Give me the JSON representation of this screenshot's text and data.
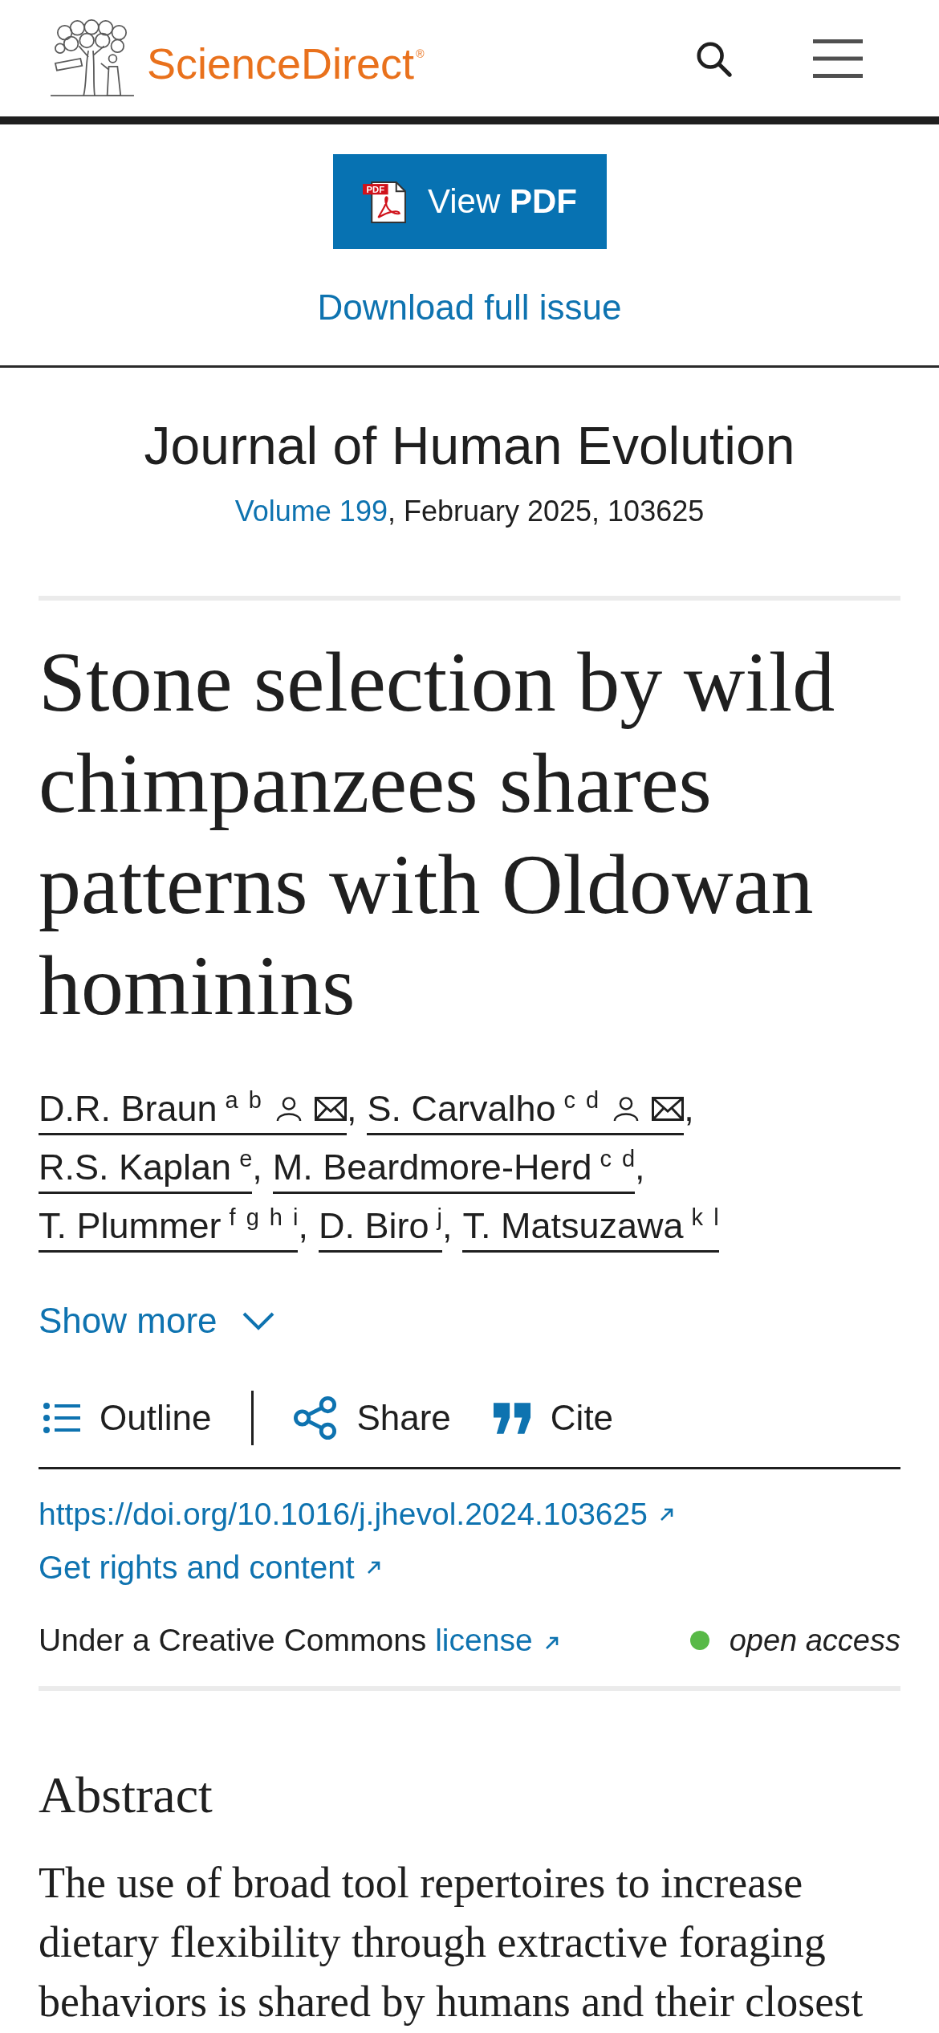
{
  "header": {
    "brand": "ScienceDirect$^{®}$"
  },
  "pdf_button": {
    "label": "View **PDF**",
    "icon_tag": "PDF"
  },
  "download_link": "Download full issue",
  "journal": {
    "title": "Journal of Human Evolution",
    "volume_link": "Volume 199",
    "issue_info": ", February 2025, 103625"
  },
  "article": {
    "title": "Stone selection by wild chimpanzees shares patterns with Oldowan hominins",
    "authors": [
      {
        "name": "D.R. Braun",
        "affiliations": "a b",
        "corresponding": true,
        "separator": ","
      },
      {
        "name": "S. Carvalho",
        "affiliations": "c d",
        "corresponding": true,
        "separator": ","
      },
      {
        "name": "R.S. Kaplan",
        "affiliations": "e",
        "corresponding": false,
        "separator": ","
      },
      {
        "name": "M. Beardmore-Herd",
        "affiliations": "c d",
        "corresponding": false,
        "separator": ","
      },
      {
        "name": "T. Plummer",
        "affiliations": "f g h i",
        "corresponding": false,
        "separator": ","
      },
      {
        "name": "D. Biro",
        "affiliations": "j",
        "corresponding": false,
        "separator": ","
      },
      {
        "name": "T. Matsuzawa",
        "affiliations": "k l",
        "corresponding": false
      }
    ],
    "show_more": {
      "label": "Show more",
      "expanded": false
    }
  },
  "toolbar": [
    {
      "kind": "outline",
      "label": "Outline"
    },
    {
      "kind": "share",
      "label": "Share"
    },
    {
      "kind": "cite",
      "label": "Cite"
    }
  ],
  "links": {
    "doi": "https://doi.org/10.1016/j.jhevol.2024.103625",
    "rights": "Get rights and content"
  },
  "license": {
    "text": "Under a Creative Commons",
    "link": "license",
    "access": "open access"
  },
  "abstract": {
    "heading": "Abstract",
    "text": "The use of broad tool repertoires to increase dietary flexibility through extractive foraging behaviors is shared by humans and their closest"
  }
}
